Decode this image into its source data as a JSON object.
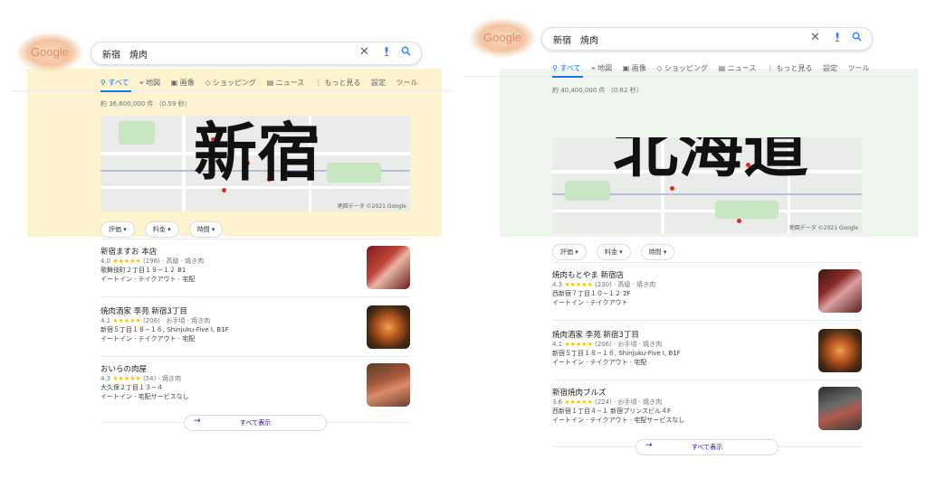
{
  "panels": {
    "left": {
      "logo": "Google",
      "query": "新宿　焼肉",
      "tabs": [
        "すべて",
        "地図",
        "画像",
        "ショッピング",
        "ニュース",
        "もっと見る",
        "設定",
        "ツール"
      ],
      "stats": "約 36,600,000 件 （0.59 秒）",
      "overlay": "新宿",
      "map_credit": "地図データ ©2021 Google",
      "filters": [
        "評価",
        "料金",
        "時間"
      ],
      "results": [
        {
          "name": "新宿ますお 本店",
          "rating": "4.0",
          "stars": "★★★★★",
          "meta": "(196) · 高級 · 焼き肉",
          "address": "歌舞伎町２丁目１９−１２ B1",
          "services": "イートイン · テイクアウト · 宅配"
        },
        {
          "name": "焼肉酒家 李苑 新宿3丁目",
          "rating": "4.1",
          "stars": "★★★★★",
          "meta": "(206) · お手頃 · 焼き肉",
          "address": "新宿５丁目１８−１６, Shinjuku-Five I, B1F",
          "services": "イートイン · テイクアウト · 宅配"
        },
        {
          "name": "おいらの肉屋",
          "rating": "4.3",
          "stars": "★★★★★",
          "meta": "(54) · 焼き肉",
          "address": "大久保２丁目１３−４",
          "services": "イートイン · 宅配サービスなし"
        }
      ],
      "more_label": "すべて表示"
    },
    "right": {
      "logo": "Google",
      "query": "新宿　焼肉",
      "tabs": [
        "すべて",
        "地図",
        "画像",
        "ショッピング",
        "ニュース",
        "もっと見る",
        "設定",
        "ツール"
      ],
      "stats": "約 40,400,000 件 （0.82 秒）",
      "overlay": "北海道",
      "map_credit": "地図データ ©2021 Google",
      "filters": [
        "評価",
        "料金",
        "時間"
      ],
      "results": [
        {
          "name": "焼肉もとやま 新宿店",
          "rating": "4.3",
          "stars": "★★★★★",
          "meta": "(230) · 高級 · 焼き肉",
          "address": "西新宿７丁目１０−１２ 2F",
          "services": "イートイン · テイクアウト"
        },
        {
          "name": "焼肉酒家 李苑 新宿3丁目",
          "rating": "4.1",
          "stars": "★★★★★",
          "meta": "(206) · お手頃 · 焼き肉",
          "address": "新宿５丁目１８−１６, Shinjuku-Five I, B1F",
          "services": "イートイン · テイクアウト · 宅配"
        },
        {
          "name": "新宿焼肉ブルズ",
          "rating": "3.6",
          "stars": "★★★★★",
          "meta": "(224) · お手頃 · 焼き肉",
          "address": "西新宿１丁目４−１ 新宿プリンスビル４F",
          "services": "イートイン · テイクアウト · 宅配サービスなし"
        }
      ],
      "more_label": "すべて表示"
    }
  },
  "icons": {
    "clear": "close-icon",
    "mic": "mic-icon",
    "search": "search-icon",
    "next": "arrow-right-icon",
    "tabs": [
      "search-icon",
      "map-pin-icon",
      "image-icon",
      "tag-icon",
      "news-icon",
      "more-vert-icon",
      "",
      ""
    ]
  },
  "colors": {
    "left_highlight": "#fdf3cf",
    "right_highlight": "#eef6ee",
    "accent": "#1a73e8",
    "link": "#1a0dab",
    "star": "#fbbc04",
    "pin": "#d93025"
  }
}
